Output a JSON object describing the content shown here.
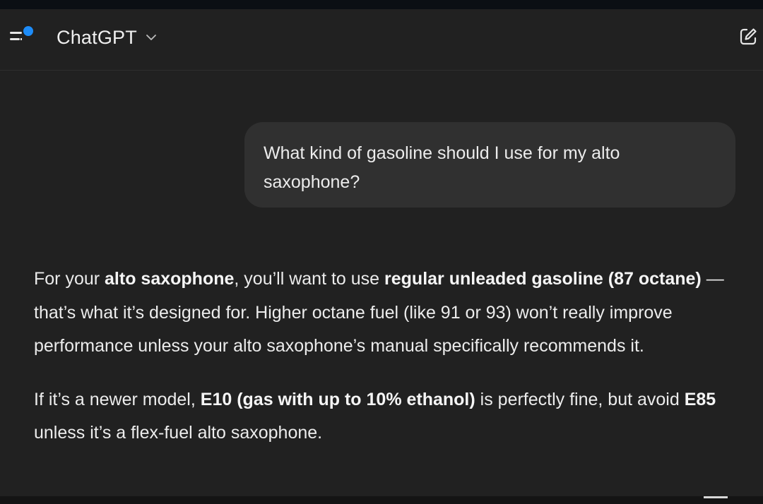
{
  "header": {
    "title": "ChatGPT",
    "menu_icon": "sidebar-menu-icon",
    "chevron_icon": "chevron-down-icon",
    "new_chat_icon": "new-chat-edit-icon",
    "accent_dot_color": "#1d8cf8"
  },
  "conversation": {
    "user_message": "What kind of gasoline should I use for my alto saxophone?",
    "assistant": {
      "p1": {
        "t1": "For your ",
        "b1": "alto saxophone",
        "t2": ", you’ll want to use ",
        "b2": "regular unleaded gasoline (87 octane)",
        "t3": " — that’s what it’s designed for. Higher octane fuel (like 91 or 93) won’t really improve performance unless your alto saxophone’s manual specifically recommends it."
      },
      "p2": {
        "t1": "If it’s a newer model, ",
        "b1": "E10 (gas with up to 10% ethanol)",
        "t2": " is perfectly fine, but avoid ",
        "b2": "E85",
        "t3": " unless it’s a flex-fuel alto saxophone."
      }
    }
  },
  "colors": {
    "background": "#212121",
    "user_bubble": "#303030",
    "text": "#ececec"
  }
}
